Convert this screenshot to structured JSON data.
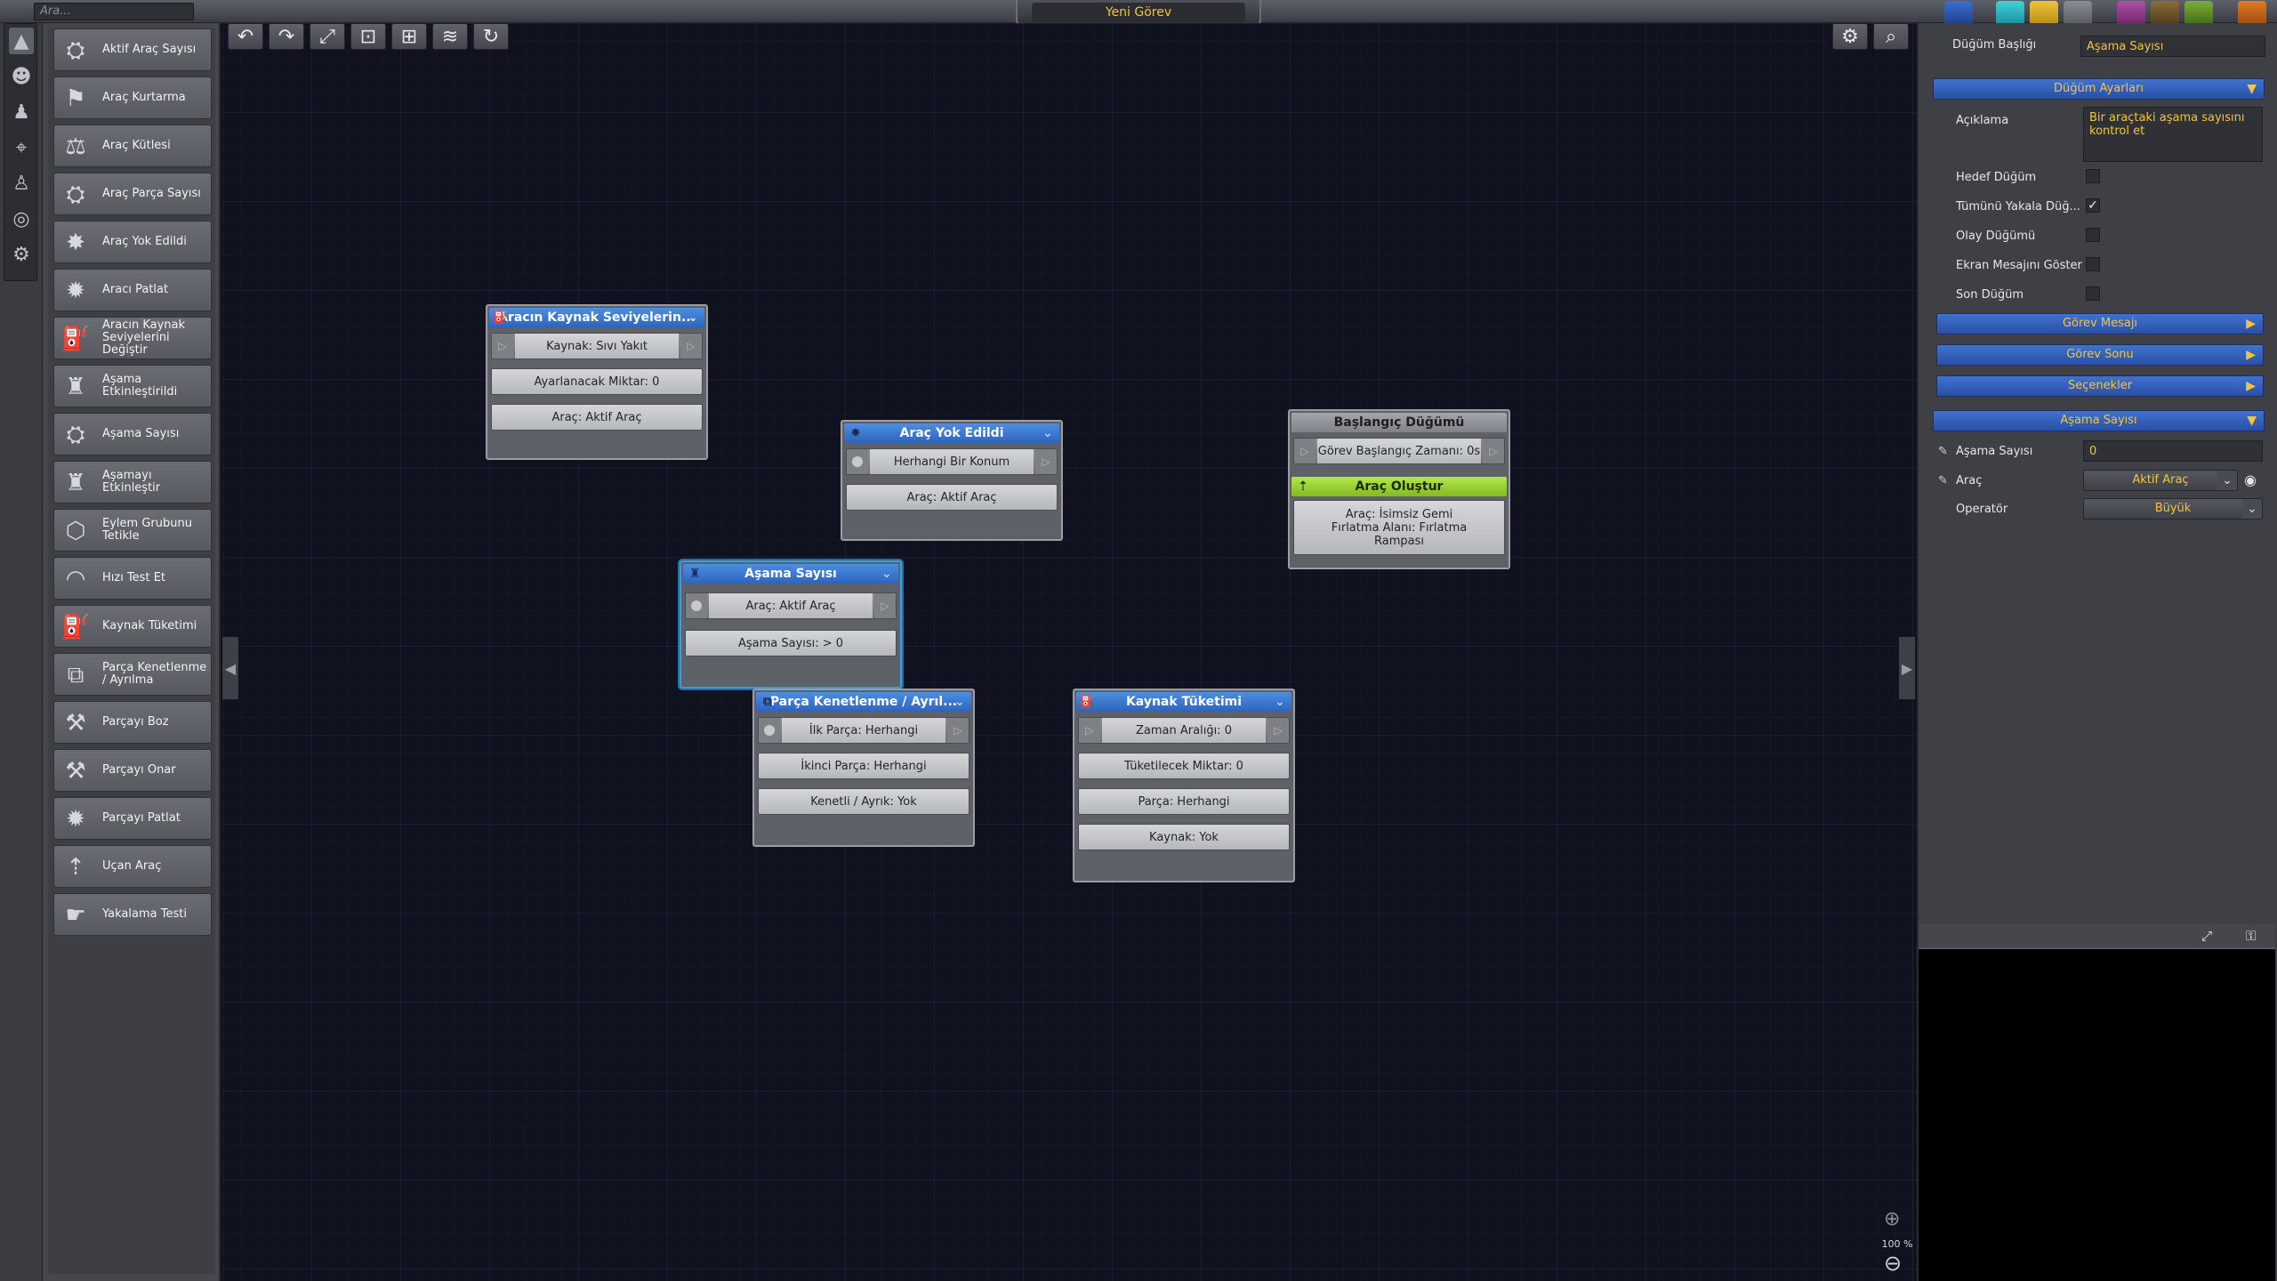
{
  "search": {
    "placeholder": "Ara..."
  },
  "window": {
    "title": "Yeni Görev"
  },
  "palette": {
    "items": [
      {
        "label": "Aktif Araç Sayısı",
        "icon": "vehicle-count-icon"
      },
      {
        "label": "Araç Kurtarma",
        "icon": "vehicle-recover-icon"
      },
      {
        "label": "Araç Kütlesi",
        "icon": "vehicle-mass-icon"
      },
      {
        "label": "Araç Parça Sayısı",
        "icon": "part-count-icon"
      },
      {
        "label": "Araç Yok Edildi",
        "icon": "vehicle-destroyed-icon"
      },
      {
        "label": "Aracı Patlat",
        "icon": "explode-vehicle-icon"
      },
      {
        "label": "Aracın Kaynak Seviyelerini Değiştir",
        "icon": "resource-level-icon"
      },
      {
        "label": "Aşama Etkinleştirildi",
        "icon": "stage-activated-icon"
      },
      {
        "label": "Aşama Sayısı",
        "icon": "stage-count-icon"
      },
      {
        "label": "Aşamayı Etkinleştir",
        "icon": "activate-stage-icon"
      },
      {
        "label": "Eylem Grubunu Tetikle",
        "icon": "action-group-icon"
      },
      {
        "label": "Hızı Test Et",
        "icon": "speed-test-icon"
      },
      {
        "label": "Kaynak Tüketimi",
        "icon": "resource-consumption-icon"
      },
      {
        "label": "Parça Kenetlenme / Ayrılma",
        "icon": "docking-icon"
      },
      {
        "label": "Parçayı Boz",
        "icon": "break-part-icon"
      },
      {
        "label": "Parçayı Onar",
        "icon": "repair-part-icon"
      },
      {
        "label": "Parçayı Patlat",
        "icon": "explode-part-icon"
      },
      {
        "label": "Uçan Araç",
        "icon": "flying-vehicle-icon"
      },
      {
        "label": "Yakalama Testi",
        "icon": "catch-test-icon"
      }
    ]
  },
  "nodes": {
    "resource_levels": {
      "title": "Aracın Kaynak Seviyelerin...",
      "row1": "Kaynak: Sıvı Yakıt",
      "row2": "Ayarlanacak Miktar: 0",
      "row3": "Araç: Aktif Araç"
    },
    "destroyed": {
      "title": "Araç Yok Edildi",
      "row1": "Herhangi Bir Konum",
      "row2": "Araç: Aktif Araç"
    },
    "start": {
      "title": "Başlangıç Düğümü",
      "row1": "Görev Başlangıç Zamanı: 0s"
    },
    "spawn": {
      "title": "Araç Oluştur",
      "row1": "Araç: İsimsiz Gemi Fırlatma Alanı: Fırlatma Rampası"
    },
    "stage_count": {
      "title": "Aşama Sayısı",
      "row1": "Araç: Aktif Araç",
      "row2": "Aşama Sayısı: > 0"
    },
    "docking": {
      "title": "Parça Kenetlenme / Ayrıl...",
      "row1": "İlk Parça: Herhangi",
      "row2": "İkinci Parça: Herhangi",
      "row3": "Kenetli / Ayrık: Yok"
    },
    "consumption": {
      "title": "Kaynak Tüketimi",
      "row1": "Zaman Aralığı: 0",
      "row2": "Tüketilecek Miktar: 0",
      "row3": "Parça: Herhangi",
      "row4": "Kaynak: Yok"
    }
  },
  "zoom": {
    "level": "100 %"
  },
  "panel": {
    "node_title_label": "Düğüm Başlığı",
    "node_title_value": "Aşama Sayısı",
    "settings_section": "Düğüm Ayarları",
    "description_label": "Açıklama",
    "description_value": "Bir araçtaki aşama sayısını kontrol et",
    "checks": [
      {
        "label": "Hedef Düğüm",
        "checked": false
      },
      {
        "label": "Tümünü Yakala Düğ...",
        "checked": true
      },
      {
        "label": "Olay Düğümü",
        "checked": false
      },
      {
        "label": "Ekran Mesajını Göster",
        "checked": false
      },
      {
        "label": "Son Düğüm",
        "checked": false
      }
    ],
    "check_mark": "✓",
    "sections": [
      "Görev Mesajı",
      "Görev Sonu",
      "Seçenekler"
    ],
    "params_section": "Aşama Sayısı",
    "param_stage_label": "Aşama Sayısı",
    "param_stage_value": "0",
    "param_vehicle_label": "Araç",
    "param_vehicle_value": "Aktif Araç",
    "param_operator_label": "Operatör",
    "param_operator_value": "Büyük"
  },
  "colors": {
    "accent": "#f2c53d",
    "node_header": "#3a78d6",
    "start_header": "#8f9297",
    "spawn_header": "#9bd33a"
  }
}
